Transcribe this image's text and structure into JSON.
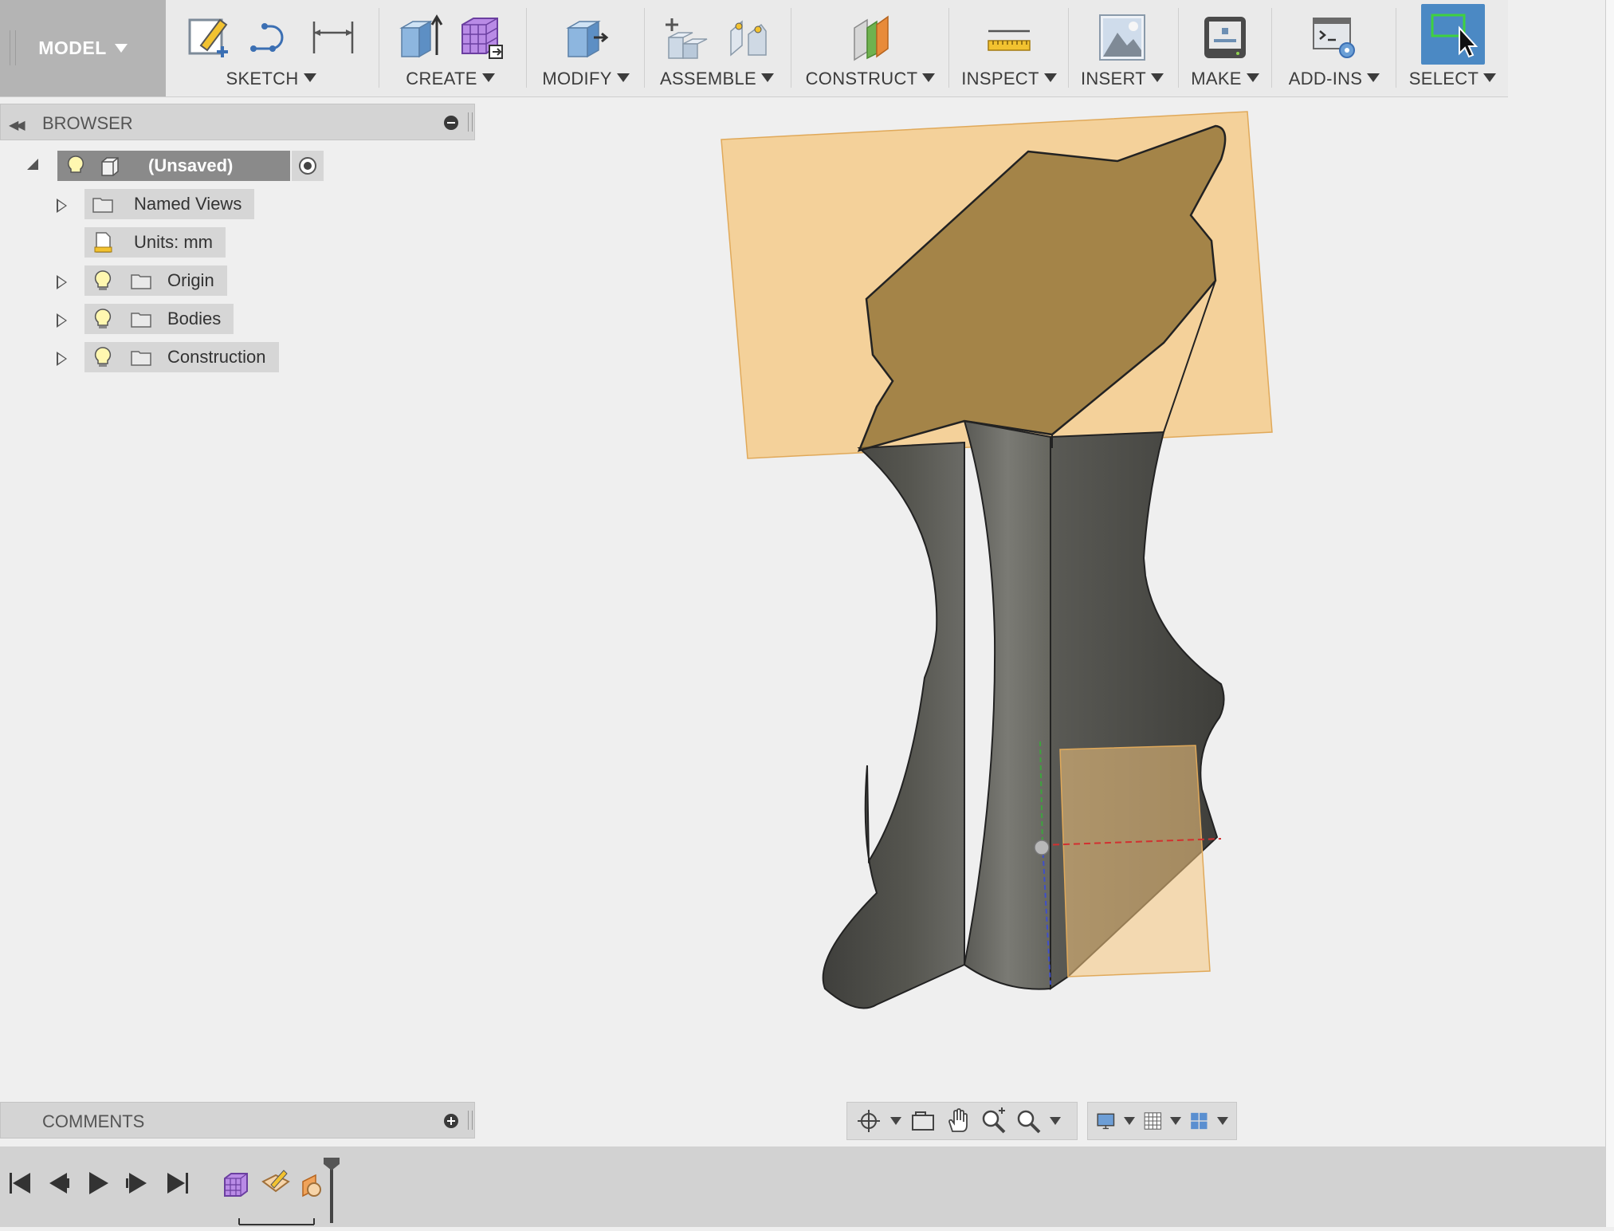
{
  "toolbar": {
    "workspace": "MODEL",
    "groups": {
      "sketch": "SKETCH",
      "create": "CREATE",
      "modify": "MODIFY",
      "assemble": "ASSEMBLE",
      "construct": "CONSTRUCT",
      "inspect": "INSPECT",
      "insert": "INSERT",
      "make": "MAKE",
      "addins": "ADD-INS",
      "select": "SELECT"
    }
  },
  "browser": {
    "title": "BROWSER",
    "root": "(Unsaved)",
    "items": {
      "named_views": "Named Views",
      "units": "Units: mm",
      "origin": "Origin",
      "bodies": "Bodies",
      "construction": "Construction"
    }
  },
  "comments": {
    "title": "COMMENTS"
  },
  "colors": {
    "plane": "#f5c77e",
    "body": "#5b5b57",
    "select_accent": "#4b89c4"
  }
}
